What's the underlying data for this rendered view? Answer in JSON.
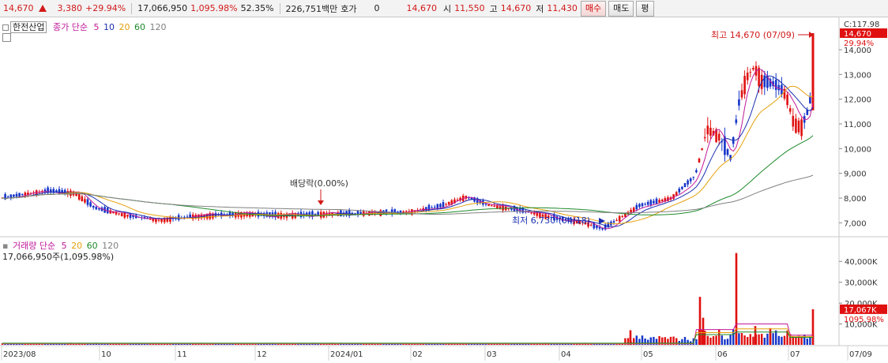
{
  "topbar": {
    "price": "14,670",
    "change": "3,380",
    "change_pct": "+29.94%",
    "volume": "17,066,950",
    "volume_ratio": "1,095.98%",
    "turnover_pct": "52.35%",
    "trade_value": "226,751백만",
    "hoga_label": "호가",
    "hoga_value": "0",
    "price2": "14,670",
    "open_label": "시",
    "open_value": "11,550",
    "high_label": "고",
    "high_value": "14,670",
    "low_label": "저",
    "low_value": "11,430",
    "buy_label": "매수",
    "sell_label": "매도",
    "avg_label": "평"
  },
  "price_panel": {
    "stock_name": "한전산업",
    "ma_label_prefix": "종가 단순",
    "ma_periods": [
      "5",
      "10",
      "20",
      "60",
      "120"
    ],
    "ma_colors": [
      "#c0189a",
      "#1a2fb0",
      "#e5a00d",
      "#1d8a2a",
      "#808080"
    ],
    "y_ticks": [
      "14,000",
      "13,000",
      "12,000",
      "11,000",
      "10,000",
      "9,000",
      "8,000",
      "7,000"
    ],
    "top_label": "C:117.98",
    "current_tag": "14,670",
    "current_pct_tag": "29.94%",
    "annotation_high": "최고 14,670 (07/09)",
    "annotation_low": "최저 6,730 (04/18)",
    "annotation_dividend": "배당락(0.00%)"
  },
  "volume_panel": {
    "label_prefix": "거래량 단순",
    "ma_periods": [
      "5",
      "20",
      "60",
      "120"
    ],
    "ma_colors": [
      "#c0189a",
      "#e5a00d",
      "#1d8a2a",
      "#808080"
    ],
    "summary": "17,066,950주(1,095.98%)",
    "y_ticks": [
      "40,000K",
      "30,000K",
      "20,000K",
      "10,000K"
    ],
    "current_tag": "17,067K",
    "current_pct_tag": "1095.98%"
  },
  "x_axis": {
    "labels": [
      "2023/08",
      "10",
      "11",
      "12",
      "2024/01",
      "02",
      "03",
      "04",
      "05",
      "06",
      "07",
      "07/09"
    ]
  },
  "colors": {
    "up": "#e01010",
    "down": "#1535c8",
    "price_tag": "#e01010",
    "grid": "#e6e6e6"
  },
  "chart_data": {
    "type": "candlestick",
    "price_ylim": [
      6500,
      14670
    ],
    "volume_ylim": [
      0,
      45000
    ],
    "volume_unit": "K",
    "key_points": [
      {
        "date": "2023/08",
        "close": 8000
      },
      {
        "date": "2023/10",
        "close": 7600
      },
      {
        "date": "2023/11",
        "close": 7100
      },
      {
        "date": "2023/12",
        "close": 7300
      },
      {
        "date": "2024/01",
        "close": 7350
      },
      {
        "date": "2024/02",
        "close": 7500
      },
      {
        "date": "2024/03",
        "close": 7600
      },
      {
        "date": "2024/04",
        "close": 7000
      },
      {
        "date": "2024/04/18",
        "close": 6730
      },
      {
        "date": "2024/05",
        "close": 7900
      },
      {
        "date": "2024/06",
        "close": 10500
      },
      {
        "date": "2024/06/late",
        "close": 13000
      },
      {
        "date": "2024/07",
        "close": 11000
      },
      {
        "date": "2024/07/09",
        "close": 14670
      }
    ],
    "current_volume_k": 17067
  }
}
